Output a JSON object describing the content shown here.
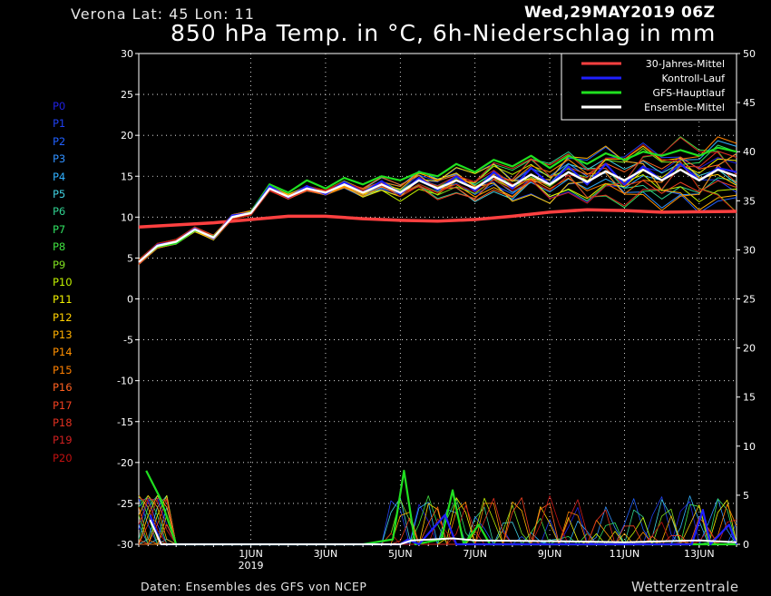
{
  "header": {
    "station": "Verona   Lat: 45 Lon: 11",
    "datetime": "Wed,29MAY2019 06Z",
    "title": "850 hPa Temp. in °C, 6h-Niederschlag in mm"
  },
  "footer": {
    "source": "Daten: Ensembles des GFS von NCEP",
    "brand": "Wetterzentrale"
  },
  "members": [
    {
      "label": "P0",
      "color": "#2020e0"
    },
    {
      "label": "P1",
      "color": "#2040f0"
    },
    {
      "label": "P2",
      "color": "#2060ff"
    },
    {
      "label": "P3",
      "color": "#3090ff"
    },
    {
      "label": "P4",
      "color": "#30b0ff"
    },
    {
      "label": "P5",
      "color": "#40d0e0"
    },
    {
      "label": "P6",
      "color": "#30d090"
    },
    {
      "label": "P7",
      "color": "#30e060"
    },
    {
      "label": "P8",
      "color": "#40e040"
    },
    {
      "label": "P9",
      "color": "#80e020"
    },
    {
      "label": "P10",
      "color": "#c0f000"
    },
    {
      "label": "P11",
      "color": "#f0f000"
    },
    {
      "label": "P12",
      "color": "#ffd000"
    },
    {
      "label": "P13",
      "color": "#ffb000"
    },
    {
      "label": "P14",
      "color": "#ff9000"
    },
    {
      "label": "P15",
      "color": "#ff8000"
    },
    {
      "label": "P16",
      "color": "#ff6020"
    },
    {
      "label": "P17",
      "color": "#f04020"
    },
    {
      "label": "P18",
      "color": "#e03020"
    },
    {
      "label": "P19",
      "color": "#d02020"
    },
    {
      "label": "P20",
      "color": "#c01010"
    }
  ],
  "chart_data": {
    "type": "line",
    "y_left": {
      "min": -30,
      "max": 30,
      "step": 5
    },
    "y_right": {
      "min": 0,
      "max": 50,
      "step": 5
    },
    "x_ticks": [
      {
        "label": "1JUN",
        "sub": "2019",
        "day": 3
      },
      {
        "label": "3JUN",
        "sub": "",
        "day": 5
      },
      {
        "label": "5JUN",
        "sub": "",
        "day": 7
      },
      {
        "label": "7JUN",
        "sub": "",
        "day": 9
      },
      {
        "label": "9JUN",
        "sub": "",
        "day": 11
      },
      {
        "label": "11JUN",
        "sub": "",
        "day": 13
      },
      {
        "label": "13JUN",
        "sub": "",
        "day": 15
      }
    ],
    "x_range_days": [
      0,
      16
    ],
    "gridlines": true,
    "legend": {
      "position": "top-right",
      "entries": [
        {
          "name": "30-Jahres-Mittel",
          "color": "#ff4040"
        },
        {
          "name": "Kontroll-Lauf",
          "color": "#2020ff"
        },
        {
          "name": "GFS-Hauptlauf",
          "color": "#20e020"
        },
        {
          "name": "Ensemble-Mittel",
          "color": "#ffffff"
        }
      ]
    },
    "series_temp": {
      "climatology_30y": [
        [
          0,
          8.8
        ],
        [
          2,
          9.3
        ],
        [
          3,
          9.7
        ],
        [
          4,
          10.1
        ],
        [
          5,
          10.1
        ],
        [
          6,
          9.8
        ],
        [
          7,
          9.6
        ],
        [
          8,
          9.5
        ],
        [
          9,
          9.7
        ],
        [
          10,
          10.1
        ],
        [
          11,
          10.6
        ],
        [
          12,
          10.9
        ],
        [
          13,
          10.8
        ],
        [
          14,
          10.6
        ],
        [
          16,
          10.7
        ]
      ],
      "ensemble_mean": [
        [
          0,
          4.5
        ],
        [
          0.5,
          6.5
        ],
        [
          1,
          7
        ],
        [
          1.5,
          8.5
        ],
        [
          2,
          7.5
        ],
        [
          2.5,
          10
        ],
        [
          3,
          10.5
        ],
        [
          3.5,
          13.5
        ],
        [
          4,
          12.5
        ],
        [
          4.5,
          13.5
        ],
        [
          5,
          13
        ],
        [
          5.5,
          14
        ],
        [
          6,
          13
        ],
        [
          6.5,
          14
        ],
        [
          7,
          13
        ],
        [
          7.5,
          14.5
        ],
        [
          8,
          13.5
        ],
        [
          8.5,
          14.5
        ],
        [
          9,
          13.5
        ],
        [
          9.5,
          15
        ],
        [
          10,
          13.8
        ],
        [
          10.5,
          15.2
        ],
        [
          11,
          14
        ],
        [
          11.5,
          15.5
        ],
        [
          12,
          14.3
        ],
        [
          12.5,
          15.6
        ],
        [
          13,
          14.5
        ],
        [
          13.5,
          15.8
        ],
        [
          14,
          14.5
        ],
        [
          14.5,
          15.8
        ],
        [
          15,
          14.5
        ],
        [
          15.5,
          15.8
        ],
        [
          16,
          15
        ]
      ],
      "control_run": [
        [
          0,
          4.5
        ],
        [
          0.5,
          6.6
        ],
        [
          1,
          7
        ],
        [
          1.5,
          8.6
        ],
        [
          2,
          7.4
        ],
        [
          2.5,
          10.2
        ],
        [
          3,
          10.5
        ],
        [
          3.5,
          13.8
        ],
        [
          4,
          12.4
        ],
        [
          4.5,
          13.8
        ],
        [
          5,
          12.8
        ],
        [
          5.5,
          14.3
        ],
        [
          6,
          13
        ],
        [
          6.5,
          14.4
        ],
        [
          7,
          12.8
        ],
        [
          7.5,
          14.8
        ],
        [
          8,
          13.3
        ],
        [
          8.5,
          15
        ],
        [
          9,
          13.2
        ],
        [
          9.5,
          15.5
        ],
        [
          10,
          13.5
        ],
        [
          10.5,
          16
        ],
        [
          11,
          14
        ],
        [
          11.5,
          16.2
        ],
        [
          12,
          14
        ],
        [
          12.5,
          16.5
        ],
        [
          13,
          14
        ],
        [
          13.5,
          16.2
        ],
        [
          14,
          14.5
        ],
        [
          14.5,
          16.5
        ],
        [
          15,
          14.5
        ],
        [
          15.5,
          16
        ],
        [
          16,
          15.5
        ]
      ],
      "gfs_main": [
        [
          0,
          4.5
        ],
        [
          0.5,
          6.4
        ],
        [
          1,
          6.8
        ],
        [
          1.5,
          8.4
        ],
        [
          2,
          7.6
        ],
        [
          2.5,
          10
        ],
        [
          3,
          10.6
        ],
        [
          3.5,
          14
        ],
        [
          4,
          13
        ],
        [
          4.5,
          14.5
        ],
        [
          5,
          13.5
        ],
        [
          5.5,
          14.8
        ],
        [
          6,
          14
        ],
        [
          6.5,
          15
        ],
        [
          7,
          14.5
        ],
        [
          7.5,
          15.5
        ],
        [
          8,
          15
        ],
        [
          8.5,
          16.5
        ],
        [
          9,
          15.5
        ],
        [
          9.5,
          17
        ],
        [
          10,
          16.2
        ],
        [
          10.5,
          17.5
        ],
        [
          11,
          16
        ],
        [
          11.5,
          17.5
        ],
        [
          12,
          16.5
        ],
        [
          12.5,
          17.8
        ],
        [
          13,
          17
        ],
        [
          13.5,
          18
        ],
        [
          14,
          17.5
        ],
        [
          14.5,
          18.2
        ],
        [
          15,
          17.5
        ],
        [
          15.5,
          18.5
        ],
        [
          16,
          18
        ]
      ]
    },
    "series_precip_mm": {
      "gfs_main": [
        [
          0.2,
          7.5
        ],
        [
          0.6,
          4.5
        ],
        [
          1,
          0
        ],
        [
          6,
          0
        ],
        [
          6.8,
          0.5
        ],
        [
          7.1,
          7.5
        ],
        [
          7.4,
          0
        ],
        [
          8.1,
          0.5
        ],
        [
          8.4,
          5.5
        ],
        [
          8.7,
          0
        ],
        [
          9.1,
          2
        ],
        [
          9.4,
          0
        ],
        [
          16,
          0
        ]
      ],
      "control_run": [
        [
          0.3,
          3
        ],
        [
          0.6,
          0
        ],
        [
          7,
          0
        ],
        [
          7.2,
          0.5
        ],
        [
          7.5,
          0
        ],
        [
          8.2,
          3
        ],
        [
          8.5,
          0
        ],
        [
          14.8,
          0
        ],
        [
          15.1,
          3.5
        ],
        [
          15.3,
          0
        ],
        [
          15.8,
          2
        ],
        [
          16,
          0
        ]
      ],
      "ensemble_mean": [
        [
          0.3,
          2.5
        ],
        [
          0.6,
          0
        ],
        [
          7,
          0
        ],
        [
          7.3,
          0.4
        ],
        [
          8.4,
          0.6
        ],
        [
          9,
          0.4
        ],
        [
          11.5,
          0.3
        ],
        [
          13,
          0.2
        ],
        [
          15,
          0.4
        ],
        [
          16,
          0.2
        ]
      ]
    }
  }
}
